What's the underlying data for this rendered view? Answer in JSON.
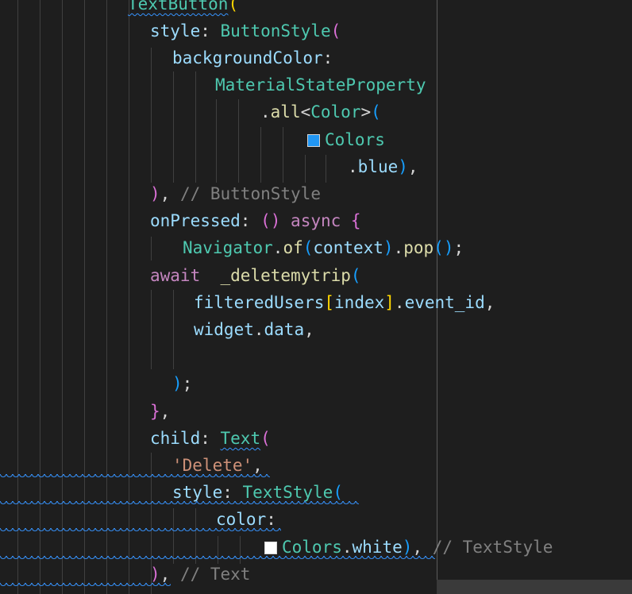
{
  "colors": {
    "background": "#1e1e1e",
    "class": "#4ec9b0",
    "property": "#9cdcfe",
    "function": "#dcdcaa",
    "keyword": "#c586c0",
    "string": "#ce9178",
    "comment": "#808080",
    "swatch_blue": "#2196f3",
    "swatch_white": "#ffffff"
  },
  "code": {
    "l0": {
      "ident": "TextButton",
      "p": "("
    },
    "l1": {
      "prop": "style",
      "colon": ": ",
      "cls": "ButtonStyle",
      "p": "("
    },
    "l2": {
      "prop": "backgroundColor",
      "colon": ":"
    },
    "l3": {
      "cls": "MaterialStateProperty"
    },
    "l4": {
      "dot": ".",
      "fn": "all",
      "lt": "<",
      "cls": "Color",
      "gt": ">",
      "p": "("
    },
    "l5": {
      "cls": "Colors"
    },
    "l6": {
      "dot": ".",
      "prop": "blue",
      "p": ")",
      "comma": ","
    },
    "l7": {
      "p": ")",
      "comma": ", ",
      "comment": "// ButtonStyle"
    },
    "l8": {
      "prop": "onPressed",
      "colon": ": ",
      "p1": "()",
      "sp": " ",
      "kw": "async",
      "sp2": " ",
      "p2": "{"
    },
    "l9": {
      "cls": "Navigator",
      "dot": ".",
      "fn": "of",
      "p": "(",
      "arg": "context",
      "pc": ")",
      "dot2": ".",
      "fn2": "pop",
      "pp": "()",
      "semi": ";"
    },
    "l10": {
      "kw": "await",
      "sp": "  ",
      "fn": "_deletemytrip",
      "p": "("
    },
    "l11": {
      "var": "filteredUsers",
      "b1": "[",
      "idx": "index",
      "b2": "]",
      "dot": ".",
      "prop": "event_id",
      "comma": ","
    },
    "l12": {
      "var": "widget",
      "dot": ".",
      "prop": "data",
      "comma": ","
    },
    "l14": {
      "p": ")",
      "semi": ";"
    },
    "l15": {
      "p": "}",
      "comma": ","
    },
    "l16": {
      "prop": "child",
      "colon": ": ",
      "cls": "Text",
      "p": "("
    },
    "l17": {
      "str": "'Delete'",
      "comma": ","
    },
    "l18": {
      "prop": "style",
      "colon": ": ",
      "cls": "TextStyle",
      "p": "("
    },
    "l19": {
      "prop": "color",
      "colon": ":"
    },
    "l20": {
      "cls": "Colors",
      "dot": ".",
      "prop": "white",
      "p": ")",
      "comma": ", ",
      "comment": "// TextStyle"
    },
    "l21": {
      "p": ")",
      "comma": ", ",
      "comment": "// Text"
    }
  }
}
